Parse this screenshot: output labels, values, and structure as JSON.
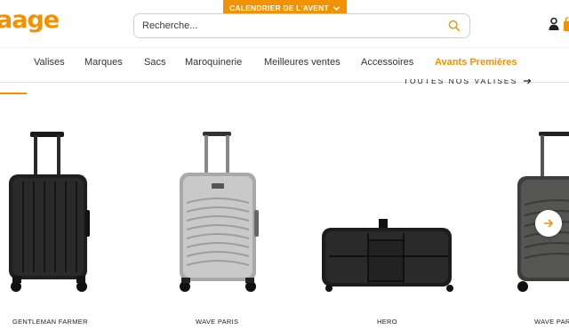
{
  "header": {
    "logo_text": "aage",
    "advent_banner": "CALENDRIER DE L'AVENT",
    "search": {
      "placeholder": "Recherche..."
    },
    "icons": [
      "search-icon",
      "user-icon",
      "bag-icon",
      "chevron-down-icon"
    ]
  },
  "nav": {
    "items": [
      {
        "label": "Valises"
      },
      {
        "label": "Marques"
      },
      {
        "label": "Sacs"
      },
      {
        "label": "Maroquinerie"
      },
      {
        "label": "Meilleures ventes"
      },
      {
        "label": "Accessoires"
      },
      {
        "label": "Avants Premières"
      }
    ]
  },
  "section": {
    "view_all": "TOUTES NOS VALISES"
  },
  "products": [
    {
      "name": "GENTLEMAN FARMER",
      "color": "#1f1f1f"
    },
    {
      "name": "WAVE PARIS",
      "color": "#bfbfbf"
    },
    {
      "name": "HERO",
      "color": "#1c1c1c"
    },
    {
      "name": "WAVE PARIS",
      "color": "#4a4a48"
    }
  ],
  "carousel": {
    "next_icon": "arrow-right-icon"
  },
  "colors": {
    "accent": "#f39200",
    "text": "#2b2b2b"
  }
}
